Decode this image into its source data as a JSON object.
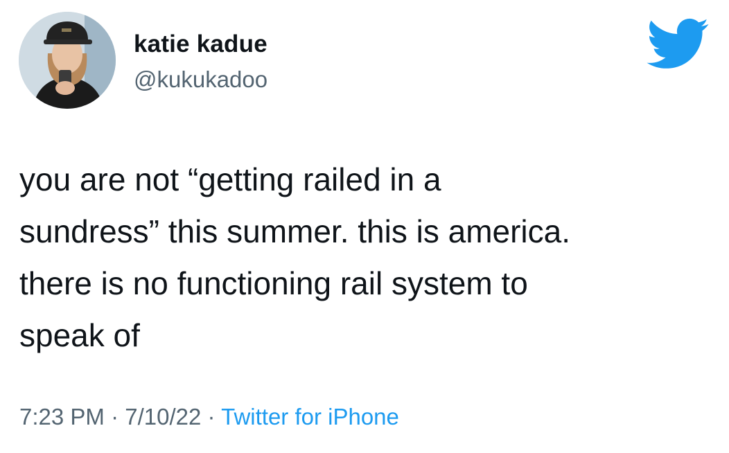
{
  "author": {
    "display_name": "katie kadue",
    "handle": "@kukukadoo",
    "avatar_icon": "profile-photo-avatar"
  },
  "brand": {
    "icon": "twitter-bird-icon",
    "color": "#1d9bf0"
  },
  "tweet": {
    "lines": [
      "you are not “getting railed in a",
      "sundress” this summer. this is america.",
      "there is no functioning rail system to",
      "speak of"
    ]
  },
  "meta": {
    "time": "7:23 PM",
    "separator": "·",
    "date": "7/10/22",
    "source": "Twitter for iPhone"
  },
  "colors": {
    "text": "#0f1419",
    "secondary": "#536471",
    "link": "#1d9bf0"
  }
}
